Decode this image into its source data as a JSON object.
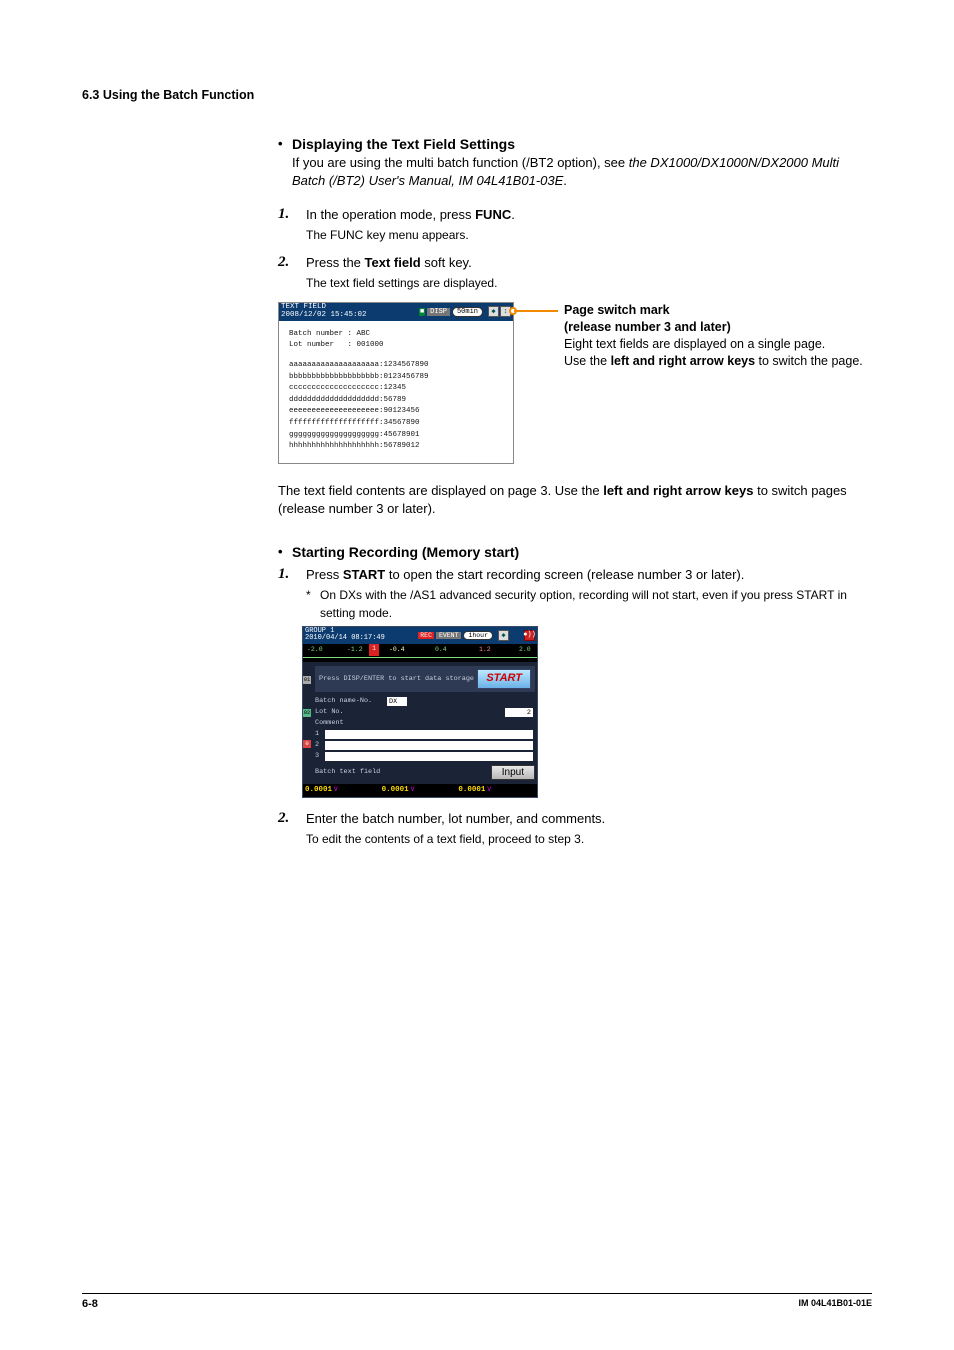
{
  "section_head": "6.3  Using the Batch Function",
  "h1": "Displaying the Text Field Settings",
  "intro_a": "If you are using the multi batch function (/BT2 option), see ",
  "intro_b_it": "the DX1000/DX1000N/DX2000 Multi Batch (/BT2) User's Manual, IM 04L41B01-03E",
  "intro_c": ".",
  "step1_num": "1.",
  "step1_a": "In the operation mode, press ",
  "step1_b": "FUNC",
  "step1_c": ".",
  "step1_sub": "The FUNC key menu appears.",
  "step2_num": "2.",
  "step2_a": "Press the ",
  "step2_b": "Text field",
  "step2_c": " soft key.",
  "step2_sub": "The text field settings are displayed.",
  "shot1": {
    "title": "TEXT FIELD\n2008/12/02 15:45:02",
    "disp": "DISP",
    "interval": "50min",
    "batch_l": "Batch number ",
    "batch_v": ": ABC",
    "lot_l": "Lot number   ",
    "lot_v": ": 001000",
    "t1": "aaaaaaaaaaaaaaaaaaaa:1234567890",
    "t2": "bbbbbbbbbbbbbbbbbbbb:0123456789",
    "t3": "cccccccccccccccccccc:12345",
    "t4": "dddddddddddddddddddd:56789",
    "t5": "eeeeeeeeeeeeeeeeeeee:90123456",
    "t6": "ffffffffffffffffffff:34567890",
    "t7": "gggggggggggggggggggg:45678901",
    "t8": "hhhhhhhhhhhhhhhhhhhh:56789012"
  },
  "callout": {
    "l1b": "Page switch mark",
    "l2b": "(release number 3 and later)",
    "l3": "Eight text fields are displayed on a single page.",
    "l4a": "Use the ",
    "l4b": "left and right arrow keys",
    "l4c": " to switch the page."
  },
  "after1a": "The text field contents are displayed on page 3. Use the ",
  "after1b": "left and right arrow keys",
  "after1c": " to switch pages (release number 3 or later).",
  "h2": "Starting Recording (Memory start)",
  "s2step1_num": "1.",
  "s2step1_a": "Press ",
  "s2step1_b": "START",
  "s2step1_c": " to open the start recording screen (release number 3 or later).",
  "s2note": "On DXs with the /AS1 advanced security option, recording will not start, even if you press START in setting mode.",
  "shot2": {
    "title": "GROUP 1\n2010/04/14 08:17:49",
    "rec": "REC",
    "evt": "EVENT",
    "interval": "1hour",
    "ruler": {
      "m20": "-2.0",
      "m12": "-1.2",
      "m04": "-0.4",
      "p04": "0.4",
      "p12": "1.2",
      "p20": "2.0",
      "flag": "1"
    },
    "msg": "Press DISP/ENTER to start data storage",
    "start": "START",
    "bn_l": "Batch name-No.",
    "bn_v": "DX",
    "ln_l": "Lot No.",
    "ln_v": "2",
    "cm_l": "Comment",
    "c1": "1",
    "c2": "2",
    "c3": "3",
    "btf": "Batch text field",
    "input": "Input",
    "f1": "0.0001",
    "f2": "0.0001",
    "f3": "0.0001",
    "unit": "V",
    "strip1": "01",
    "strip2": "02",
    "strip3": "0"
  },
  "s2step2_num": "2.",
  "s2step2_a": "Enter the batch number, lot number, and comments.",
  "s2step2_sub": "To edit the contents of a text field, proceed to step 3.",
  "footer_l": "6-8",
  "footer_r": "IM 04L41B01-01E"
}
